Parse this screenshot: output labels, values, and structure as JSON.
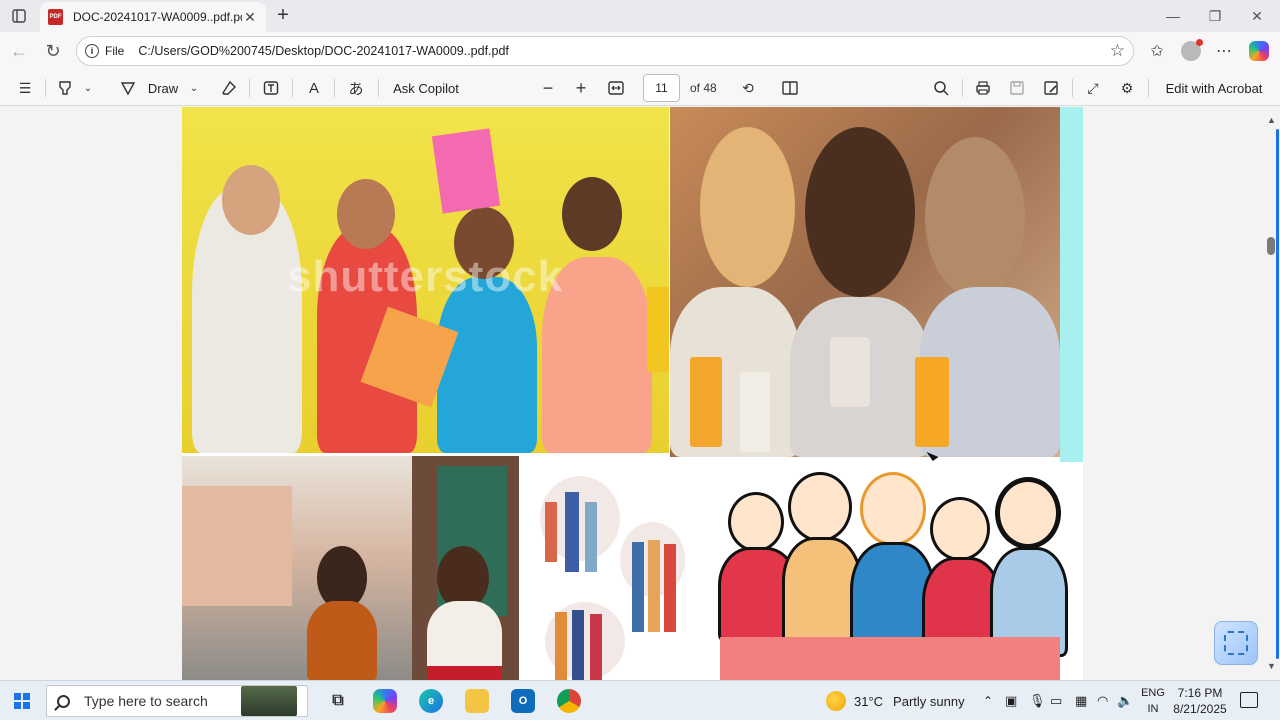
{
  "browser": {
    "tab": {
      "title": "DOC-20241017-WA0009..pdf.pdf",
      "favicon": "PDF"
    },
    "address": {
      "scheme": "File",
      "url": "C:/Users/GOD%200745/Desktop/DOC-20241017-WA0009..pdf.pdf"
    }
  },
  "pdf_toolbar": {
    "draw_label": "Draw",
    "ask_copilot_label": "Ask Copilot",
    "current_page": "11",
    "page_count": "of 48",
    "edit_acrobat_label": "Edit with Acrobat",
    "read_aloud_glyph": "A",
    "translate_glyph": "あ"
  },
  "document": {
    "watermark": "shutterstock"
  },
  "taskbar": {
    "search_placeholder": "Type here to search",
    "weather": {
      "temp": "31°C",
      "condition": "Partly sunny"
    },
    "language": {
      "line1": "ENG",
      "line2": "IN"
    },
    "clock": {
      "time": "7:16 PM",
      "date": "8/21/2025"
    }
  },
  "colors": {
    "accent": "#1a73e8",
    "toolbar_bg": "#f7f7f7",
    "page_bg": "#f3f3f3",
    "taskbar_bg": "#e7eef6"
  }
}
